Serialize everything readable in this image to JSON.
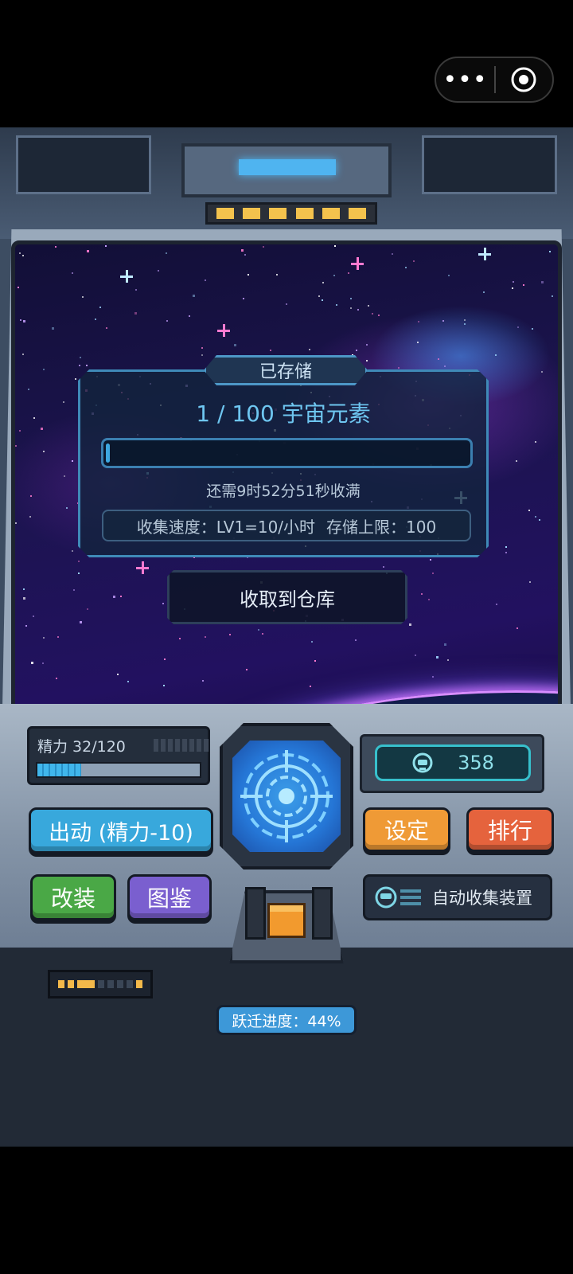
{
  "storage": {
    "tag": "已存储",
    "amount": "1 / 100 宇宙元素",
    "fill_fraction": 0.01,
    "remaining": "还需9时52分51秒收满",
    "speed": "收集速度：LV1=10/小时",
    "capacity": "存储上限：100",
    "collect_button": "收取到仓库"
  },
  "energy": {
    "label": "精力 32/120",
    "fill_fraction": 0.27
  },
  "coins": {
    "value": "358"
  },
  "buttons": {
    "sortie": "出动 (精力-10)",
    "settings": "设定",
    "rank": "排行",
    "modify": "改装",
    "codex": "图鉴",
    "auto_collect": "自动收集装置"
  },
  "jump": {
    "label": "跃迁进度：44%"
  },
  "icons": {
    "capsule_more": "more-dots-icon",
    "capsule_close": "target-close-icon",
    "radar": "radar-target-icon",
    "coin": "helmet-coin-icon",
    "auto_collect": "collector-device-icon"
  },
  "colors": {
    "sortie": "#38a8dc",
    "settings": "#ef9a36",
    "rank": "#e5633d",
    "modify": "#4aa846",
    "codex": "#7a5fcf",
    "jump": "#3d98d8"
  }
}
